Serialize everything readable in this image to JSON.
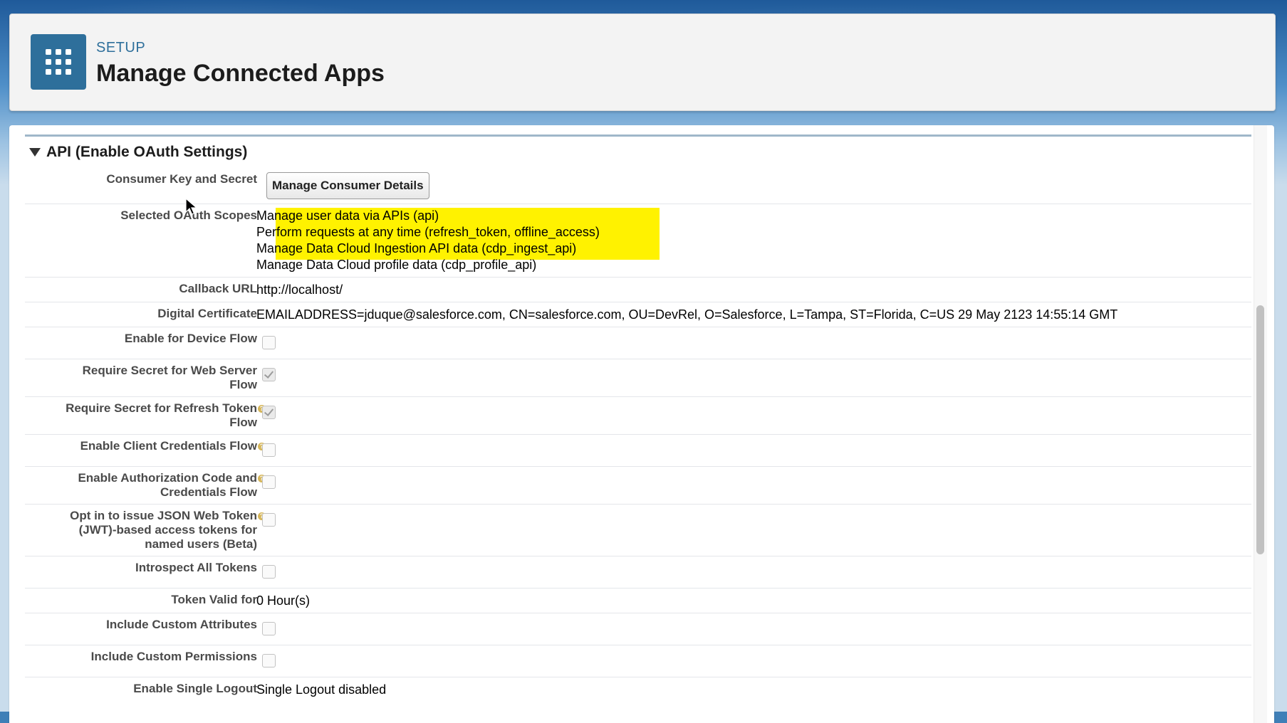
{
  "header": {
    "setup_label": "SETUP",
    "title": "Manage Connected Apps",
    "icon": "app-grid-icon"
  },
  "section": {
    "title": "API (Enable OAuth Settings)"
  },
  "fields": {
    "consumer_key": {
      "label": "Consumer Key and Secret",
      "button": "Manage Consumer Details"
    },
    "oauth_scopes": {
      "label": "Selected OAuth Scopes",
      "scopes": [
        "Manage user data via APIs (api)",
        "Perform requests at any time (refresh_token, offline_access)",
        "Manage Data Cloud Ingestion API data (cdp_ingest_api)",
        "Manage Data Cloud profile data (cdp_profile_api)"
      ],
      "highlight_color": "#fff200"
    },
    "callback_url": {
      "label": "Callback URL",
      "value": "http://localhost/"
    },
    "digital_certificate": {
      "label": "Digital Certificate",
      "value": "EMAILADDRESS=jduque@salesforce.com, CN=salesforce.com, OU=DevRel, O=Salesforce, L=Tampa, ST=Florida, C=US 29 May 2123 14:55:14 GMT"
    },
    "device_flow": {
      "label": "Enable for Device Flow",
      "checked": false
    },
    "secret_web_server": {
      "label_line1": "Require Secret for Web Server",
      "label_line2": "Flow",
      "checked": true
    },
    "secret_refresh": {
      "label_line1": "Require Secret for Refresh Token",
      "label_line2": "Flow",
      "checked": true
    },
    "client_credentials": {
      "label": "Enable Client Credentials Flow",
      "checked": false
    },
    "auth_code_credentials": {
      "label_line1": "Enable Authorization Code and",
      "label_line2": "Credentials Flow",
      "checked": false
    },
    "jwt_tokens": {
      "label_line1": "Opt in to issue JSON Web Token",
      "label_line2": "(JWT)-based access tokens for",
      "label_line3": "named users (Beta)",
      "checked": false
    },
    "introspect": {
      "label": "Introspect All Tokens",
      "checked": false
    },
    "token_valid": {
      "label": "Token Valid for",
      "value": "0 Hour(s)"
    },
    "custom_attributes": {
      "label": "Include Custom Attributes",
      "checked": false
    },
    "custom_permissions": {
      "label": "Include Custom Permissions",
      "checked": false
    },
    "single_logout": {
      "label": "Enable Single Logout",
      "value": "Single Logout disabled"
    }
  },
  "help_icon_glyph": "?"
}
